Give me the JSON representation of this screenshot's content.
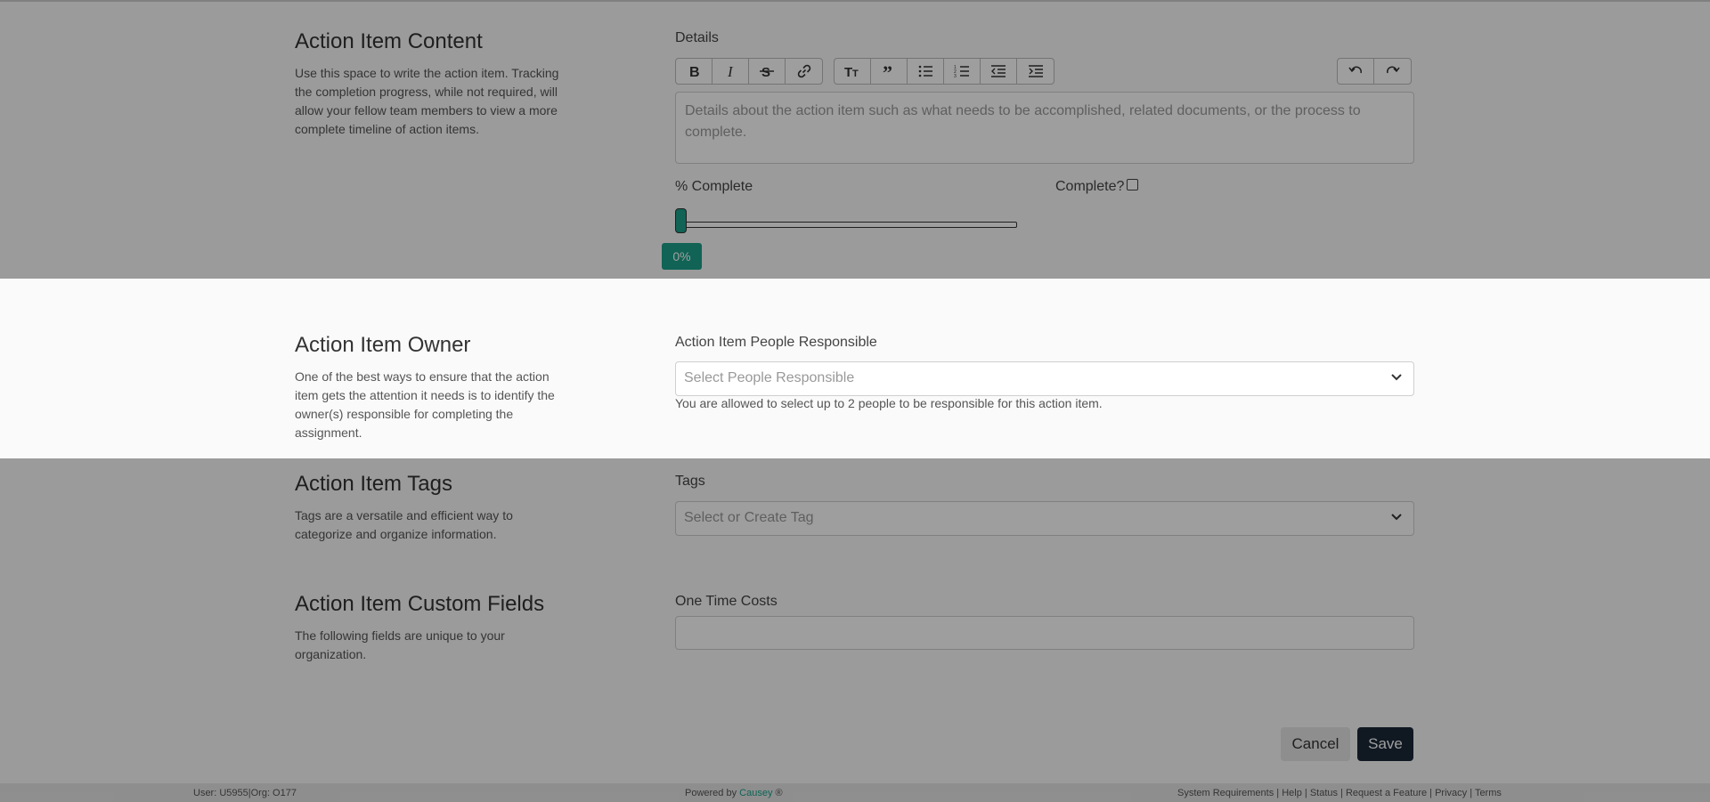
{
  "content": {
    "title": "Action Item Content",
    "description": "Use this space to write the action item. Tracking the completion progress, while not required, will allow your fellow team members to view a more complete timeline of action items.",
    "details_label": "Details",
    "details_placeholder": "Details about the action item such as what needs to be accomplished, related documents, or the process to complete.",
    "percent_label": "% Complete",
    "percent_value": 0,
    "percent_display": "0%",
    "complete_label": "Complete?",
    "complete_checked": false,
    "toolbar_icons": [
      "bold-icon",
      "italic-icon",
      "strikethrough-icon",
      "link-icon",
      "heading-icon",
      "quote-icon",
      "bullet-list-icon",
      "numbered-list-icon",
      "outdent-icon",
      "indent-icon",
      "undo-icon",
      "redo-icon"
    ]
  },
  "owner": {
    "title": "Action Item Owner",
    "description": "One of the best ways to ensure that the action item gets the attention it needs is to identify the owner(s) responsible for completing the assignment.",
    "people_label": "Action Item People Responsible",
    "people_placeholder": "Select People Responsible",
    "people_help": "You are allowed to select up to 2 people to be responsible for this action item."
  },
  "tags": {
    "title": "Action Item Tags",
    "description": "Tags are a versatile and efficient way to categorize and organize information.",
    "tags_label": "Tags",
    "tags_placeholder": "Select or Create Tag"
  },
  "custom": {
    "title": "Action Item Custom Fields",
    "description": "The following fields are unique to your organization.",
    "one_time_costs_label": "One Time Costs",
    "one_time_costs_value": ""
  },
  "actions": {
    "cancel_label": "Cancel",
    "save_label": "Save"
  },
  "footer": {
    "user_info": "User: U5955|Org: O177",
    "powered_by": "Powered by",
    "brand": "Causey",
    "brand_mark": "®",
    "links": [
      "System Requirements",
      "Help",
      "Status",
      "Request a Feature",
      "Privacy",
      "Terms"
    ]
  },
  "colors": {
    "accent": "#1aa18a",
    "save_button": "#1b2738",
    "overlay": "rgba(0,0,0,0.38)"
  }
}
